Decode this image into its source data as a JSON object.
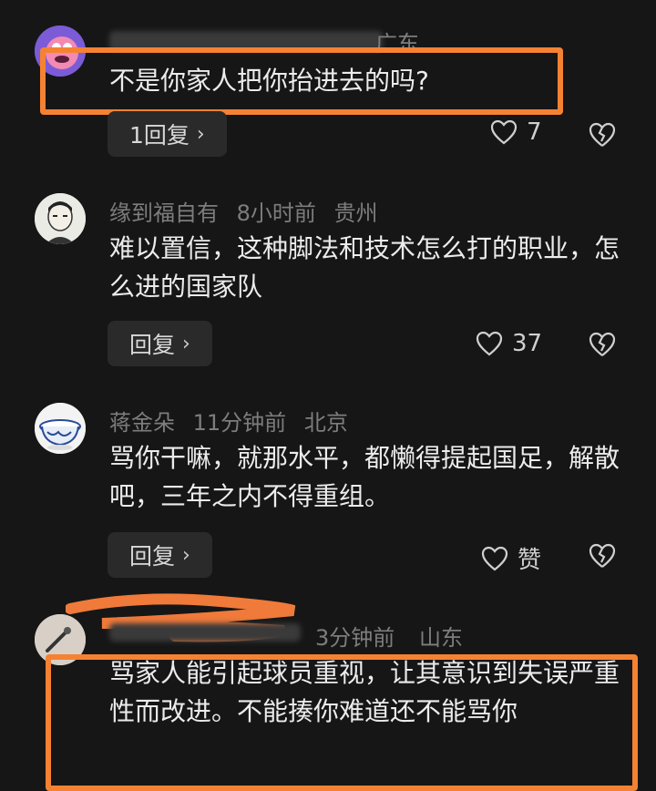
{
  "comments": [
    {
      "user": "",
      "time": "",
      "location": "广东",
      "text": "不是你家人把你抬进去的吗?",
      "reply_label": "1回复",
      "likes": "7"
    },
    {
      "user": "缘到福自有",
      "time": "8小时前",
      "location": "贵州",
      "text": "难以置信，这种脚法和技术怎么打的职业，怎么进的国家队",
      "reply_label": "回复",
      "likes": "37"
    },
    {
      "user": "蒋金朵",
      "time": "11分钟前",
      "location": "北京",
      "text": "骂你干嘛，就那水平，都懒得提起国足，解散吧，三年之内不得重组。",
      "reply_label": "回复",
      "likes": "赞"
    },
    {
      "user": "",
      "time": "3分钟前",
      "location": "山东",
      "text": "骂家人能引起球员重视，让其意识到失误严重性而改进。不能揍你难道还不能骂你",
      "reply_label": "",
      "likes": ""
    }
  ],
  "colors": {
    "background": "#161616",
    "highlight": "#f58232",
    "meta_text": "#7d7d7d"
  },
  "icons": [
    "heart-icon",
    "broken-heart-icon",
    "chevron-right-icon"
  ]
}
